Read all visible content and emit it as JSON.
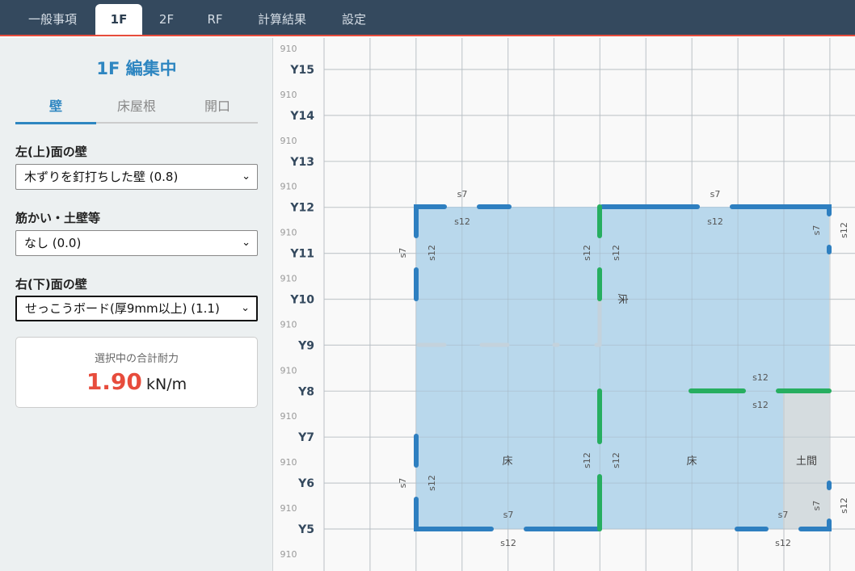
{
  "nav": {
    "tabs": [
      "一般事項",
      "1F",
      "2F",
      "RF",
      "計算結果",
      "設定"
    ],
    "active": "1F"
  },
  "sidebar": {
    "title": "1F 編集中",
    "tabs": [
      "壁",
      "床屋根",
      "開口"
    ],
    "left_wall": {
      "label": "左(上)面の壁",
      "value": "木ずりを釘打ちした壁 (0.8)"
    },
    "brace": {
      "label": "筋かい・土壁等",
      "value": "なし (0.0)"
    },
    "right_wall": {
      "label": "右(下)面の壁",
      "value": "せっこうボード(厚9mm以上) (1.1)"
    },
    "total": {
      "caption": "選択中の合計耐力",
      "value": "1.90",
      "unit": "kN/m"
    }
  },
  "canvas": {
    "span": "910",
    "rows": [
      "Y15",
      "Y14",
      "Y13",
      "Y12",
      "Y11",
      "Y10",
      "Y9",
      "Y8",
      "Y7",
      "Y6",
      "Y5"
    ],
    "labels": {
      "s7": "s7",
      "s12": "s12",
      "floor": "床",
      "doma": "土間"
    },
    "colors": {
      "wall": "#2e7fc0",
      "brace": "#27ae60",
      "floor": "#b9d8ec",
      "doma": "#d5dcdf"
    }
  }
}
